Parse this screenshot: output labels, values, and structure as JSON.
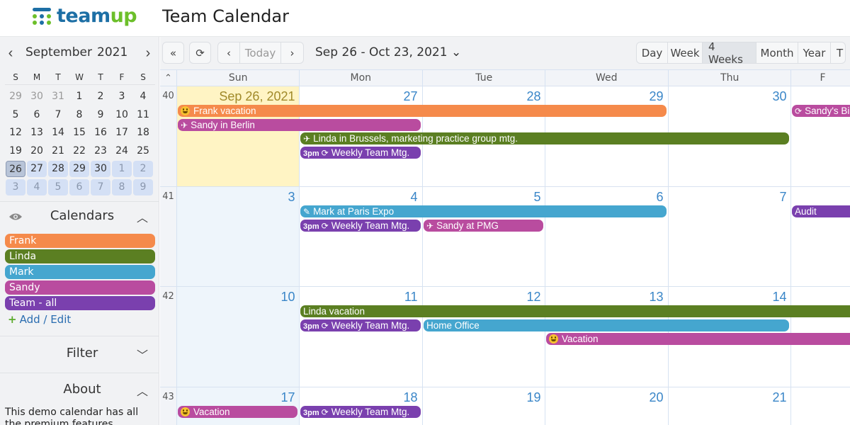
{
  "header": {
    "logo_text_a": "team",
    "logo_text_b": "up",
    "title": "Team Calendar"
  },
  "colors": {
    "frank": "#f58a4b",
    "linda": "#5b7f22",
    "mark": "#45a6cf",
    "sandy": "#b94c9f",
    "team": "#7a40ae",
    "logo_blue": "#1d6fa5",
    "logo_green": "#6cbf2a"
  },
  "mini_calendar": {
    "month": "September",
    "year": "2021",
    "prev_icon": "‹",
    "next_icon": "›",
    "weekdays": [
      "S",
      "M",
      "T",
      "W",
      "T",
      "F",
      "S"
    ],
    "weeks": [
      [
        "29",
        "30",
        "31",
        "1",
        "2",
        "3",
        "4"
      ],
      [
        "5",
        "6",
        "7",
        "8",
        "9",
        "10",
        "11"
      ],
      [
        "12",
        "13",
        "14",
        "15",
        "16",
        "17",
        "18"
      ],
      [
        "19",
        "20",
        "21",
        "22",
        "23",
        "24",
        "25"
      ],
      [
        "26",
        "27",
        "28",
        "29",
        "30",
        "1",
        "2"
      ],
      [
        "3",
        "4",
        "5",
        "6",
        "7",
        "8",
        "9"
      ]
    ],
    "selected": "26"
  },
  "calendars": {
    "title": "Calendars",
    "items": [
      {
        "name": "Frank",
        "key": "frank"
      },
      {
        "name": "Linda",
        "key": "linda"
      },
      {
        "name": "Mark",
        "key": "mark"
      },
      {
        "name": "Sandy",
        "key": "sandy"
      },
      {
        "name": "Team - all",
        "key": "team"
      }
    ],
    "add_edit": "Add / Edit"
  },
  "filter": {
    "title": "Filter"
  },
  "about": {
    "title": "About",
    "text": "This demo calendar has all the premium features"
  },
  "toolbar": {
    "first_icon": "«",
    "refresh_icon": "⟳",
    "prev_icon": "‹",
    "today": "Today",
    "next_icon": "›",
    "range": "Sep 26 - Oct 23, 2021",
    "range_chevron": "⌄",
    "views": [
      "Day",
      "Week",
      "4 Weeks",
      "Month",
      "Year",
      "T"
    ],
    "active_view": "4 Weeks"
  },
  "grid": {
    "collapse_icon": "⌃",
    "weekdays": [
      "Sun",
      "Mon",
      "Tue",
      "Wed",
      "Thu",
      "F"
    ],
    "weeks": [
      {
        "num": "40",
        "days": [
          "Sep 26, 2021",
          "27",
          "28",
          "29",
          "30",
          ""
        ]
      },
      {
        "num": "41",
        "days": [
          "3",
          "4",
          "5",
          "6",
          "7",
          ""
        ]
      },
      {
        "num": "42",
        "days": [
          "10",
          "11",
          "12",
          "13",
          "14",
          ""
        ]
      },
      {
        "num": "43",
        "days": [
          "17",
          "18",
          "19",
          "20",
          "21",
          ""
        ]
      }
    ],
    "events": [
      {
        "week": 0,
        "start": 0,
        "span": 4,
        "row": 0,
        "cal": "frank",
        "icon": "smiley",
        "title": "Frank vacation"
      },
      {
        "week": 0,
        "start": 0,
        "span": 2,
        "row": 1,
        "cal": "sandy",
        "icon": "plane",
        "title": "Sandy in Berlin"
      },
      {
        "week": 0,
        "start": 1,
        "span": 4,
        "row": 2,
        "cal": "linda",
        "icon": "plane",
        "title": "Linda in Brussels, marketing practice group mtg."
      },
      {
        "week": 0,
        "start": 1,
        "span": 1,
        "row": 3,
        "cal": "team",
        "time": "3pm",
        "icon": "repeat",
        "title": "Weekly Team Mtg."
      },
      {
        "week": 0,
        "start": 5,
        "span": 1,
        "row": 0,
        "cal": "sandy",
        "icon": "repeat",
        "title": "Sandy's Bi",
        "open": true
      },
      {
        "week": 1,
        "start": 1,
        "span": 3,
        "row": 0,
        "cal": "mark",
        "icon": "pencil",
        "title": "Mark at Paris Expo"
      },
      {
        "week": 1,
        "start": 1,
        "span": 1,
        "row": 1,
        "cal": "team",
        "time": "3pm",
        "icon": "repeat",
        "title": "Weekly Team Mtg."
      },
      {
        "week": 1,
        "start": 2,
        "span": 1,
        "row": 1,
        "cal": "sandy",
        "icon": "plane",
        "title": "Sandy at PMG"
      },
      {
        "week": 1,
        "start": 5,
        "span": 1,
        "row": 0,
        "cal": "team",
        "title": "Audit",
        "open": true
      },
      {
        "week": 2,
        "start": 1,
        "span": 5,
        "row": 0,
        "cal": "linda",
        "title": "Linda vacation",
        "open": true
      },
      {
        "week": 2,
        "start": 1,
        "span": 1,
        "row": 1,
        "cal": "team",
        "time": "3pm",
        "icon": "repeat",
        "title": "Weekly Team Mtg."
      },
      {
        "week": 2,
        "start": 2,
        "span": 3,
        "row": 1,
        "cal": "mark",
        "title": "Home Office"
      },
      {
        "week": 2,
        "start": 3,
        "span": 3,
        "row": 2,
        "cal": "sandy",
        "icon": "smiley",
        "title": "Vacation",
        "open": true
      },
      {
        "week": 3,
        "start": 0,
        "span": 1,
        "row": 0,
        "cal": "sandy",
        "icon": "smiley",
        "title": "Vacation"
      },
      {
        "week": 3,
        "start": 1,
        "span": 1,
        "row": 0,
        "cal": "team",
        "time": "3pm",
        "icon": "repeat",
        "title": "Weekly Team Mtg."
      }
    ]
  }
}
